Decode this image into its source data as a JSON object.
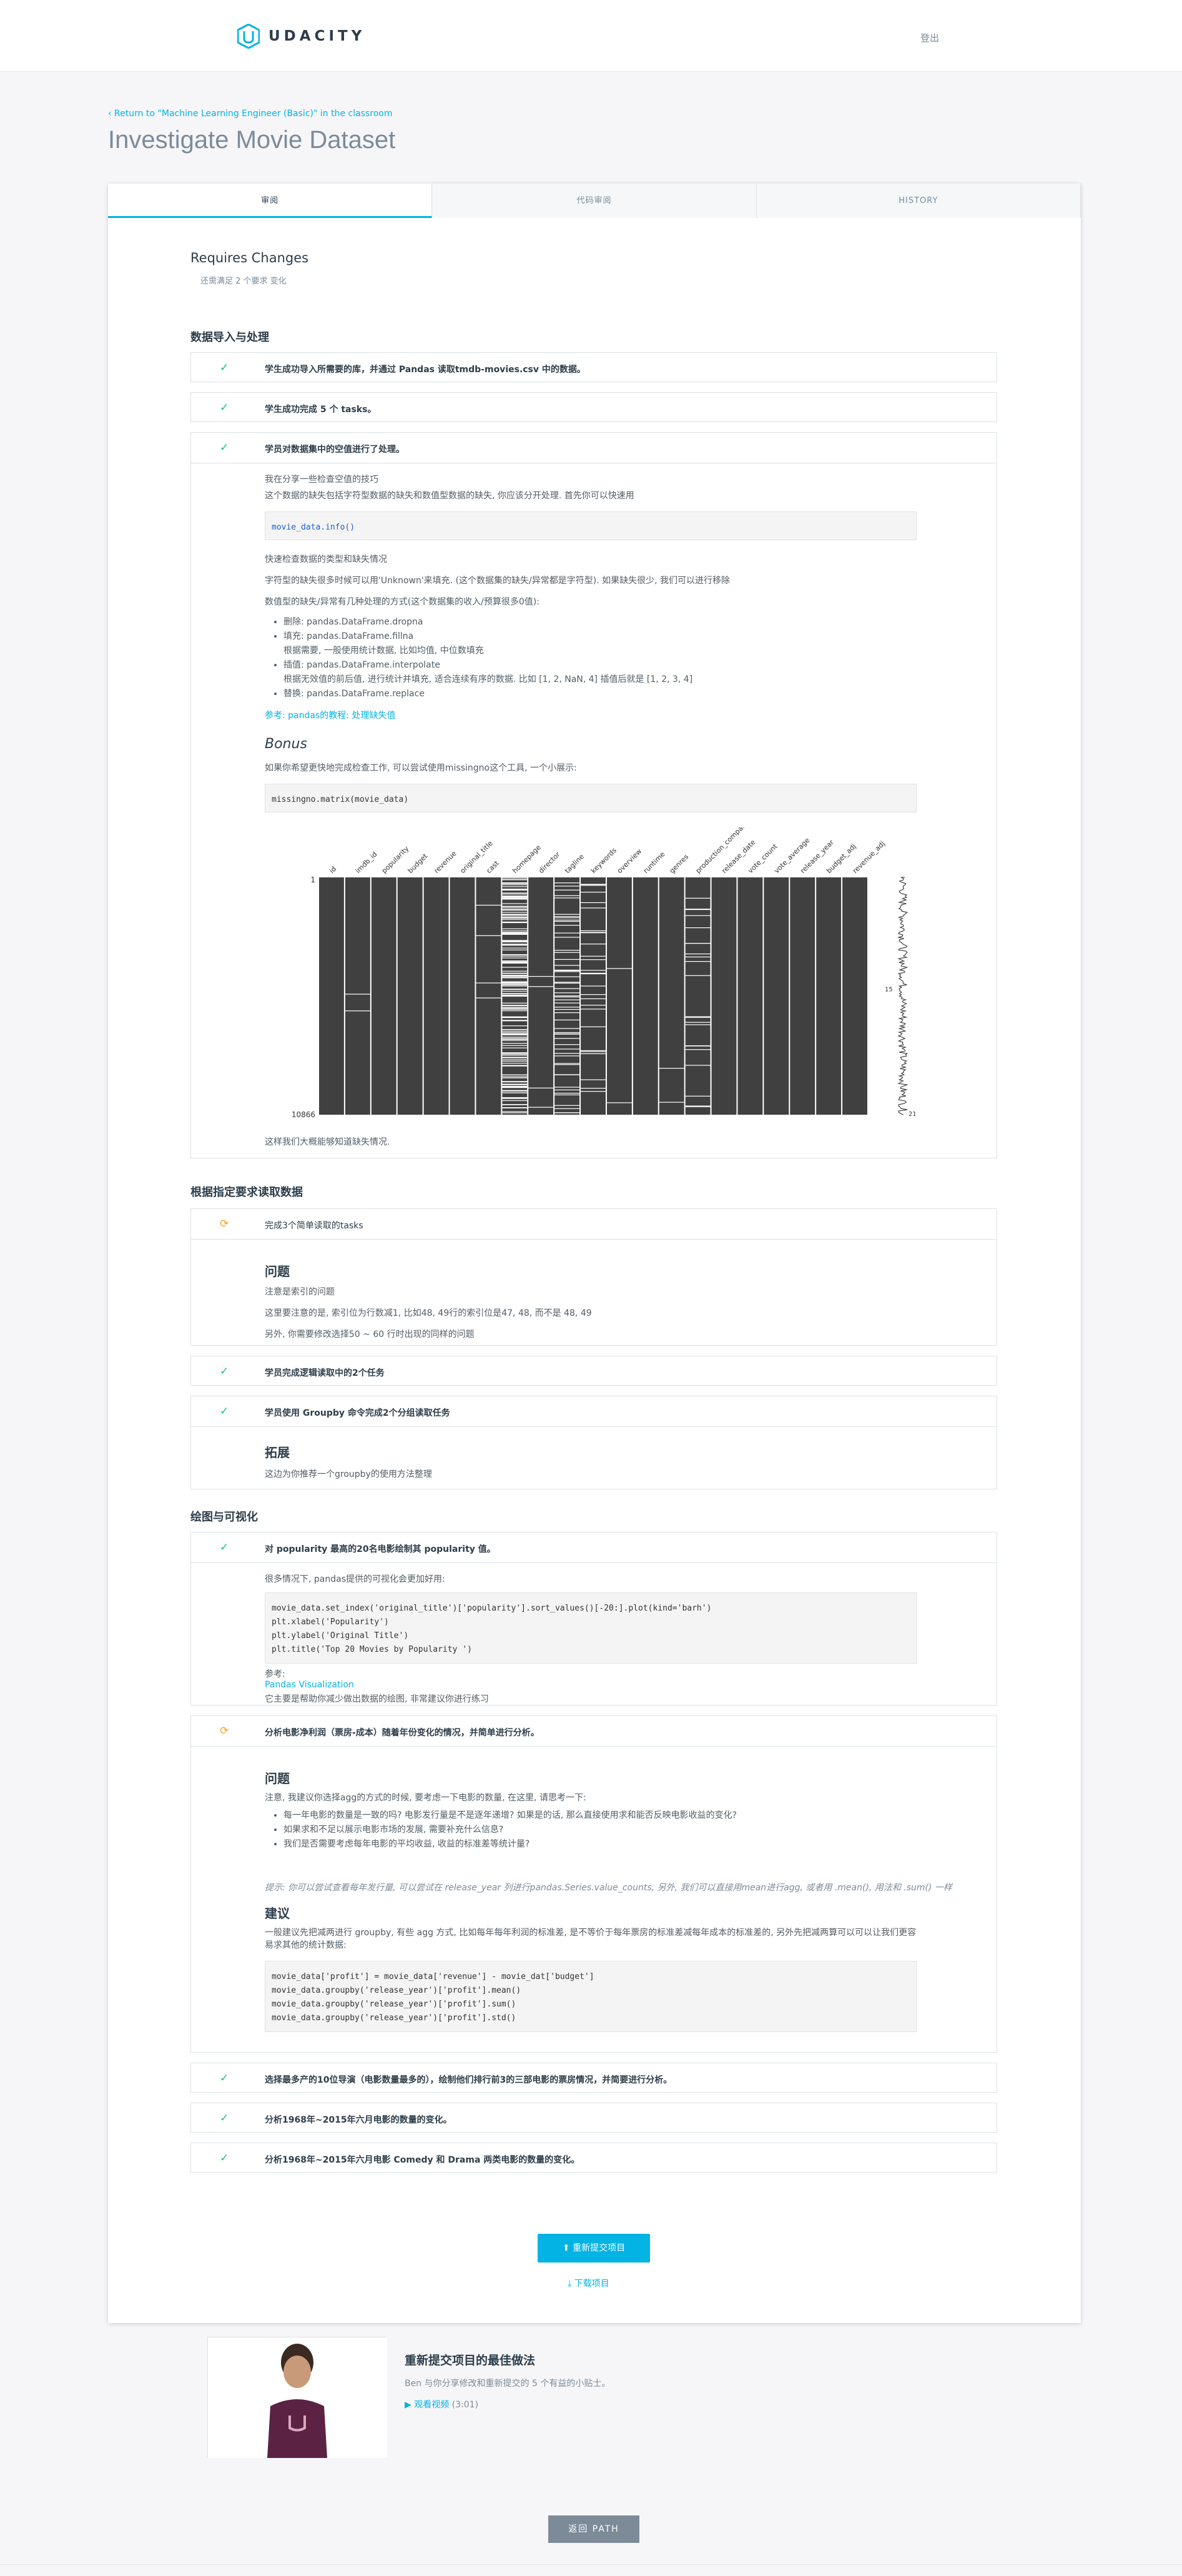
{
  "header": {
    "brand": "UDACITY",
    "logout": "登出"
  },
  "back_link": "‹ Return to \"Machine Learning Engineer (Basic)\" in the classroom",
  "page_title": "Investigate Movie Dataset",
  "tabs": [
    "审阅",
    "代码审阅",
    "HISTORY"
  ],
  "status": {
    "title": "Requires Changes",
    "subtitle": "还需满足 2 个要求 变化"
  },
  "sections": [
    {
      "title": "数据导入与处理"
    },
    {
      "title": "根据指定要求读取数据"
    },
    {
      "title": "绘图与可视化"
    }
  ],
  "rows": {
    "r1": "学生成功导入所需要的库，并通过 Pandas 读取tmdb-movies.csv 中的数据。",
    "r2": "学生成功完成 5 个 tasks。",
    "r3": "学员对数据集中的空值进行了处理。",
    "r4": "完成3个简单读取的tasks",
    "r5": "学员完成逻辑读取中的2个任务",
    "r6": "学员使用 Groupby 命令完成2个分组读取任务",
    "r7": "对 popularity 最高的20名电影绘制其 popularity 值。",
    "r8": "分析电影净利润（票房-成本）随着年份变化的情况，并简单进行分析。",
    "r9": "选择最多产的10位导演（电影数量最多的），绘制他们排行前3的三部电影的票房情况，并简要进行分析。",
    "r10": "分析1968年~2015年六月电影的数量的变化。",
    "r11": "分析1968年~2015年六月电影 Comedy 和 Drama 两类电影的数量的变化。"
  },
  "null_review": {
    "p1": "我在分享一些检查空值的技巧",
    "p2": "这个数据的缺失包括字符型数据的缺失和数值型数据的缺失, 你应该分开处理. 首先你可以快速用",
    "code1": "movie_data.info()",
    "p3": "快速检查数据的类型和缺失情况",
    "p4": "字符型的缺失很多时候可以用'Unknown'来填充. (这个数据集的缺失/异常都是字符型). 如果缺失很少, 我们可以进行移除",
    "p5": "数值型的缺失/异常有几种处理的方式(这个数据集的收入/预算很多0值):",
    "bullets": [
      "删除: pandas.DataFrame.dropna",
      "填充: pandas.DataFrame.fillna",
      "根据需要, 一般使用统计数据, 比如均值, 中位数填充",
      "插值: pandas.DataFrame.interpolate",
      "根据无效值的前后值, 进行统计并填充, 适合连续有序的数据. 比如 [1, 2, NaN, 4] 插值后就是 [1, 2, 3, 4]",
      "替换: pandas.DataFrame.replace"
    ],
    "ref": "参考: pandas的教程: 处理缺失值",
    "bonus": "Bonus",
    "p6": "如果你希望更快地完成检查工作, 可以尝试使用missingno这个工具, 一个小展示:",
    "code2": "missingno.matrix(movie_data)",
    "p7": "这样我们大概能够知道缺失情况."
  },
  "chart_data": {
    "type": "heatmap",
    "columns": [
      "id",
      "imdb_id",
      "popularity",
      "budget",
      "revenue",
      "original_title",
      "cast",
      "homepage",
      "director",
      "tagline",
      "keywords",
      "overview",
      "runtime",
      "genres",
      "production_companies",
      "release_date",
      "vote_count",
      "vote_average",
      "release_year",
      "budget_adj",
      "revenue_adj"
    ],
    "row_start": "1",
    "row_end": "10866",
    "spark_labels": [
      "15",
      "21"
    ]
  },
  "tasks_review": {
    "heading": "问题",
    "p1": "注意是索引的问题",
    "p2": "这里要注意的是, 索引位为行数减1, 比如48, 49行的索引位是47, 48, 而不是 48, 49",
    "p3": "另外, 你需要修改选择50 ~ 60 行时出现的同样的问题"
  },
  "groupby_review": {
    "heading": "拓展",
    "p1": "这边为你推荐一个groupby的使用方法整理"
  },
  "popularity_review": {
    "p1": "很多情况下, pandas提供的可视化会更加好用:",
    "code": "movie_data.set_index('original_title')['popularity'].sort_values()[-20:].plot(kind='barh')\nplt.xlabel('Popularity')\nplt.ylabel('Original Title')\nplt.title('Top 20 Movies by Popularity ')",
    "p2": "参考:",
    "link": "Pandas Visualization",
    "p3": "它主要是帮助你减少做出数据的绘图, 非常建议你进行练习"
  },
  "profit_review": {
    "heading": "问题",
    "p1": "注意, 我建议你选择agg的方式的时候, 要考虑一下电影的数量, 在这里, 请思考一下:",
    "bullets": [
      "每一年电影的数量是一致的吗? 电影发行量是不是逐年递增? 如果是的话, 那么直接使用求和能否反映电影收益的变化?",
      "如果求和不足以展示电影市场的发展, 需要补充什么信息?",
      "我们是否需要考虑每年电影的平均收益, 收益的标准差等统计量?"
    ],
    "hint": "提示: 你可以尝试查看每年发行量, 可以尝试在 release_year 列进行pandas.Series.value_counts, 另外, 我们可以直接用mean进行agg, 或者用 .mean(), 用法和 .sum() 一样",
    "heading2": "建议",
    "p2": "一般建议先把减两进行 groupby, 有些 agg 方式, 比如每年每年利润的标准差, 是不等价于每年票房的标准差减每年成本的标准差的, 另外先把减两算可以可以让我们更容易求其他的统计数据:",
    "code": "movie_data['profit'] = movie_data['revenue'] - movie_dat['budget']\nmovie_data.groupby('release_year')['profit'].mean()\nmovie_data.groupby('release_year')['profit'].sum()\nmovie_data.groupby('release_year')['profit'].std()"
  },
  "actions": {
    "submit": "重新提交项目",
    "download": "下载项目"
  },
  "video": {
    "title": "重新提交项目的最佳做法",
    "desc": "Ben 与你分享修改和重新提交的 5 个有益的小贴士。",
    "link": "观看视频",
    "duration": "(3:01)"
  },
  "path_button": "返回 PATH"
}
